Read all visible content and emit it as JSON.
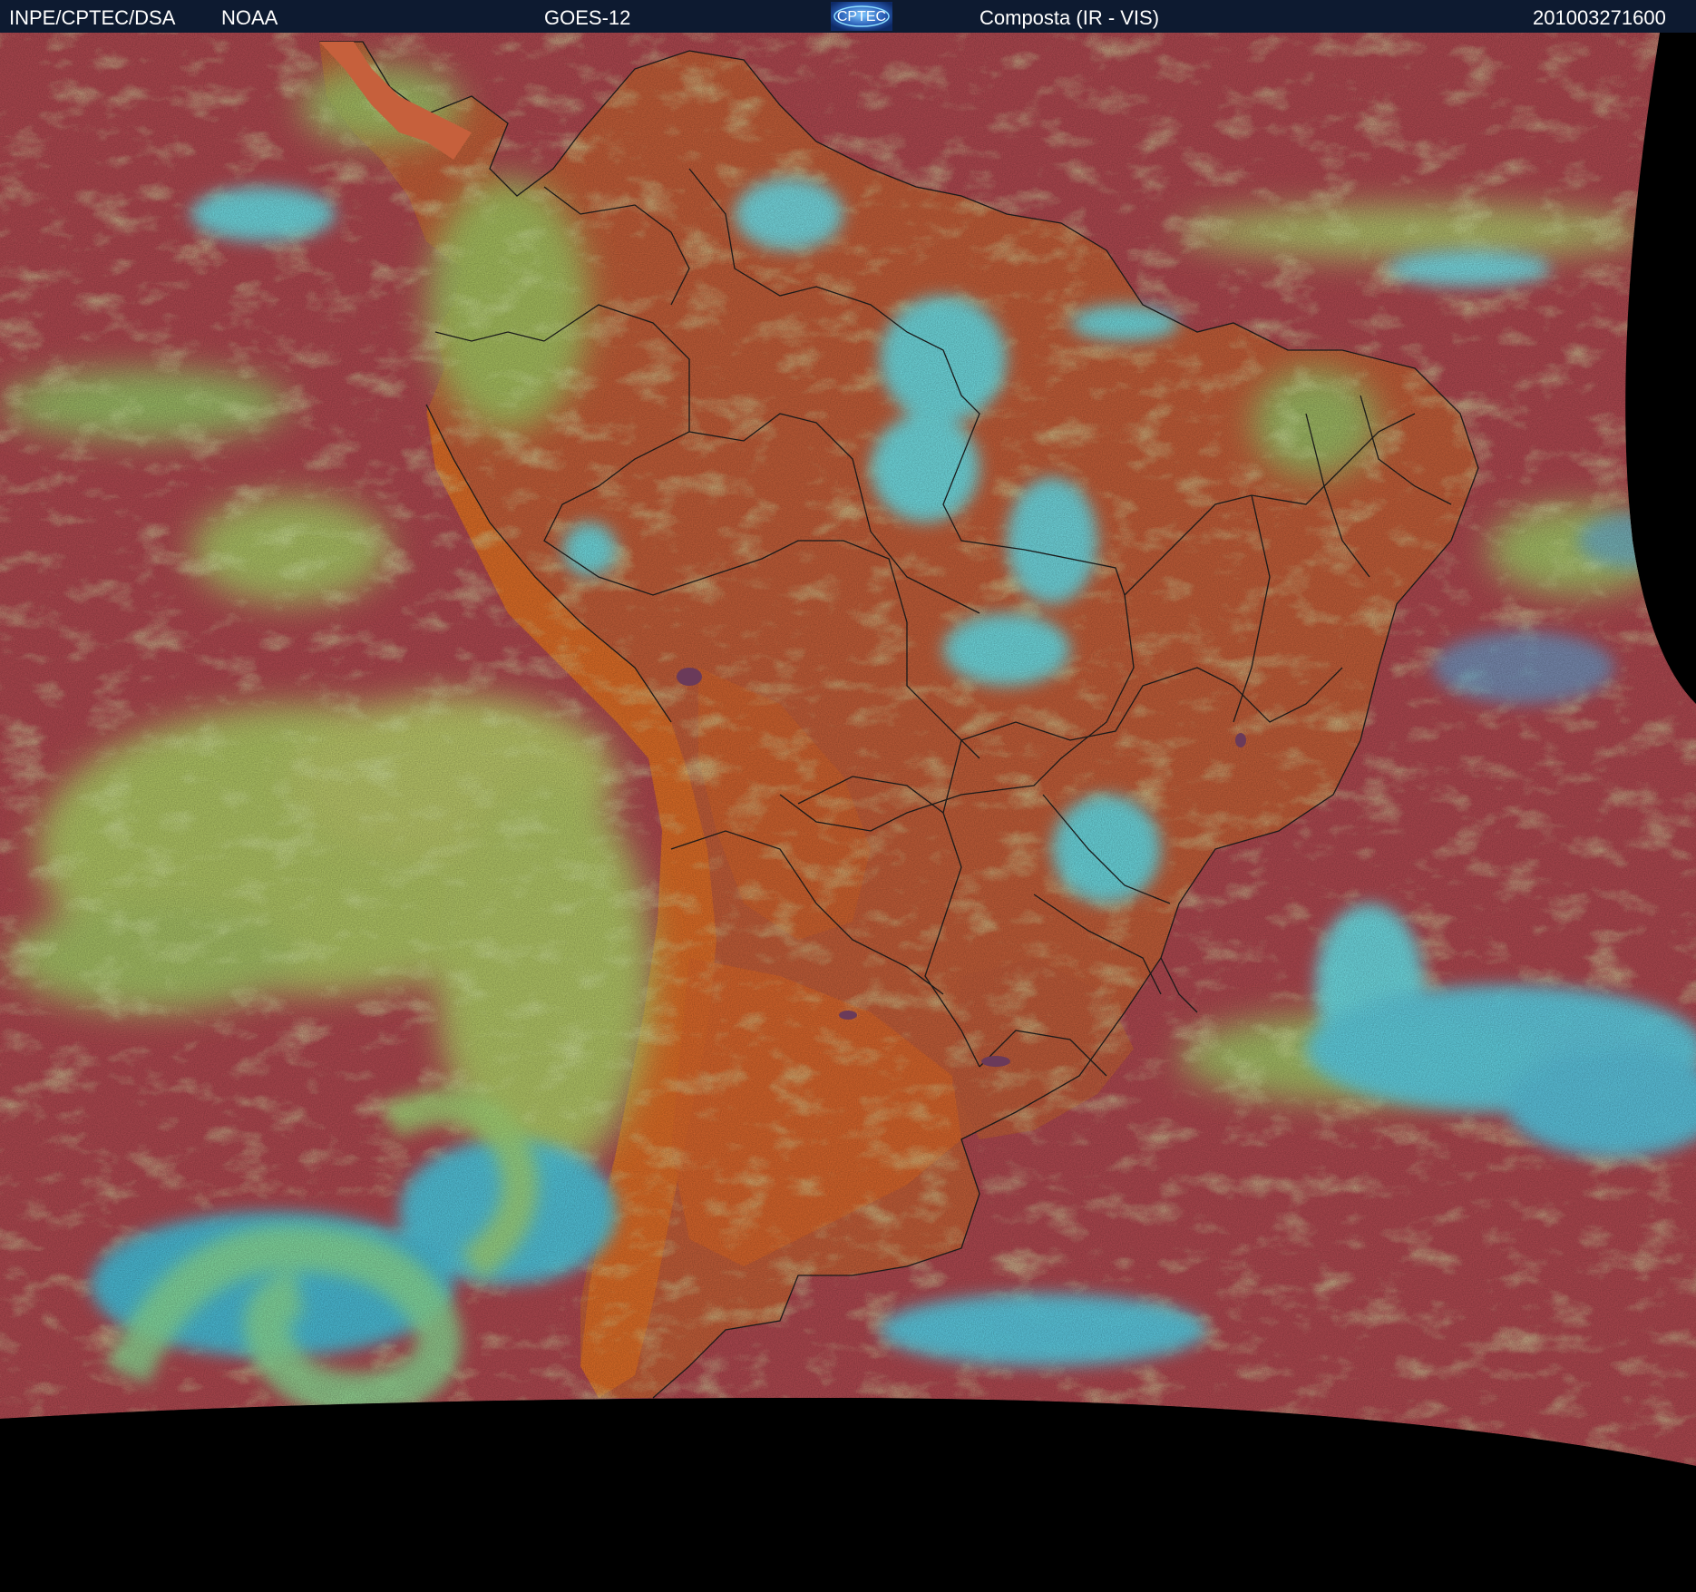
{
  "header": {
    "institution": "INPE/CPTEC/DSA",
    "agency": "NOAA",
    "satellite": "GOES-12",
    "logo_text": "CPTEC",
    "product": "Composta (IR - VIS)",
    "timestamp": "201003271600"
  },
  "colors": {
    "header_background": "#0d1a30",
    "header_text": "#ffffff",
    "ocean_clear": "#b44a52",
    "land_clear": "#c8603a",
    "andes_desert": "#e47028",
    "low_cloud": "#b6d86a",
    "high_cloud": "#6ee6ee",
    "space": "#000000",
    "borders": "#1a1a1a"
  },
  "map": {
    "description_icon": "satellite-composite-map",
    "region": "South America"
  }
}
